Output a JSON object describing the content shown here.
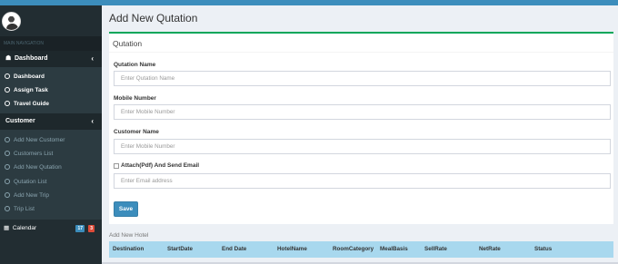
{
  "sidebar": {
    "header": "MAIN NAVIGATION",
    "dashboard_group": "Dashboard",
    "dashboard_items": [
      "Dashboard",
      "Assign Task",
      "Travel Guide"
    ],
    "customer_group": "Customer",
    "customer_items": [
      "Add New Customer",
      "Customers List",
      "Add New Qutation",
      "Qutation List",
      "Add New Trip",
      "Trip List"
    ],
    "calendar": "Calendar",
    "calendar_badges": [
      "17",
      "3"
    ]
  },
  "page_title": "Add New Qutation",
  "form": {
    "title": "Qutation",
    "qutation_name_label": "Qutation Name",
    "qutation_name_placeholder": "Enter Qutation Name",
    "mobile_label": "Mobile Number",
    "mobile_placeholder": "Enter Mobile Number",
    "customer_label": "Customer Name",
    "customer_placeholder": "Enter Mobile Number",
    "attach_label": "Attach(Pdf) And Send Email",
    "email_placeholder": "Enter Email address",
    "save_label": "Save"
  },
  "hotel": {
    "title": "Add New Hotel",
    "columns": [
      "Destination",
      "StartDate",
      "End Date",
      "HotelName",
      "RoomCategory",
      "MealBasis",
      "SellRate",
      "NetRate",
      "Status"
    ]
  },
  "colors": {
    "accent": "#3c8dbc",
    "sidebar": "#222d32",
    "box_top": "#00a65a",
    "table_header": "#a8d8ee"
  }
}
